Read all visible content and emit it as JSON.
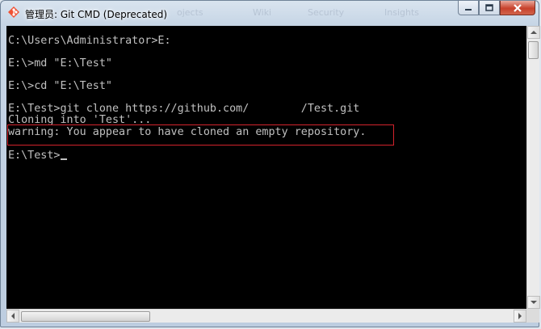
{
  "window": {
    "title": "管理员: Git CMD (Deprecated)",
    "background_tabs": [
      "ojects",
      "Wiki",
      "Security",
      "Insights"
    ]
  },
  "controls": {
    "minimize_icon": "minimize-icon",
    "maximize_icon": "maximize-icon",
    "close_icon": "close-icon"
  },
  "console": {
    "lines": [
      "C:\\Users\\Administrator>E:",
      "",
      "E:\\>md \"E:\\Test\"",
      "",
      "E:\\>cd \"E:\\Test\"",
      "",
      "E:\\Test>git clone https://github.com/        /Test.git",
      "Cloning into 'Test'...",
      "warning: You appear to have cloned an empty repository.",
      "",
      "E:\\Test>"
    ]
  },
  "colors": {
    "console_bg": "#000000",
    "console_text": "#c0c0c0",
    "highlight_border": "#d3232c",
    "close_button": "#c7412c"
  }
}
